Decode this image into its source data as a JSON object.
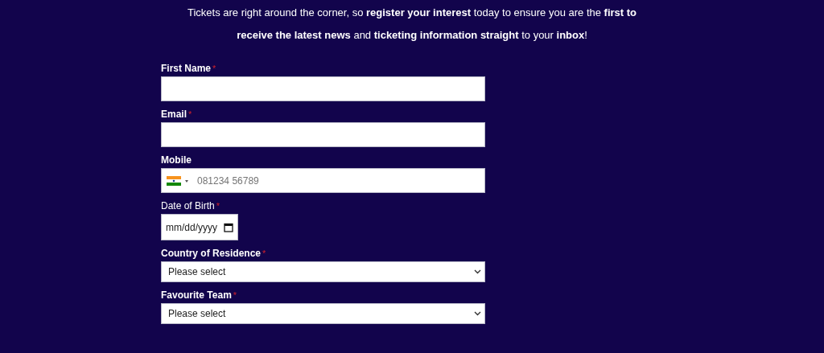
{
  "intro": "Tickets are right around the corner, so **register your interest** today to ensure you are the **first to receive the latest news** and **ticketing information straight** to your **inbox**!",
  "fields": [
    {
      "kind": "text",
      "label": "First Name",
      "bold": true,
      "required_mark": "*"
    },
    {
      "kind": "text",
      "label": "Email",
      "bold": true,
      "required_mark": "*"
    },
    {
      "kind": "phone",
      "label": "Mobile",
      "bold": true,
      "placeholder": "081234 56789"
    },
    {
      "kind": "date",
      "label": "Date of Birth",
      "bold": false,
      "required_mark": "*",
      "placeholder": "mm/dd/yyyy"
    },
    {
      "kind": "select",
      "label": "Country of Residence",
      "bold": true,
      "required_mark": "*",
      "value": "Please select"
    },
    {
      "kind": "select",
      "label": "Favourite Team",
      "bold": true,
      "required_mark": "*",
      "value": "Please select"
    }
  ]
}
